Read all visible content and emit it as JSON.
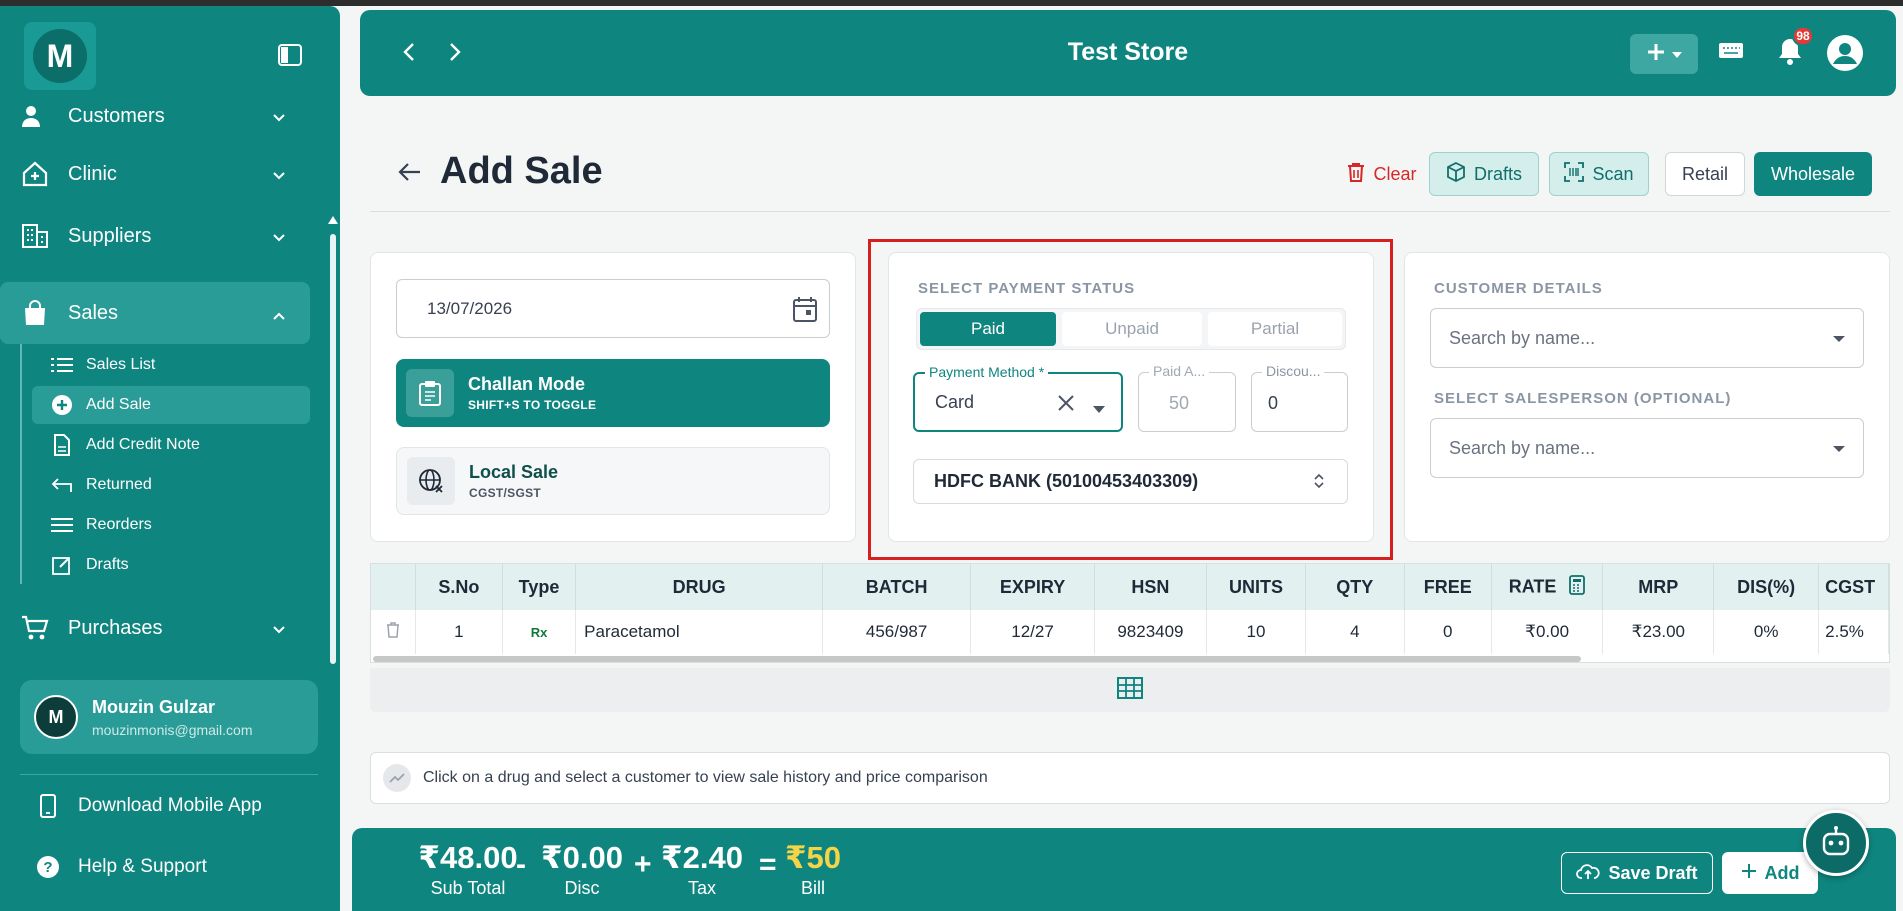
{
  "header": {
    "title": "Test Store",
    "notification_count": "98"
  },
  "sidebar": {
    "logo_letter": "M",
    "items": [
      {
        "label": "Customers",
        "icon": "users-icon"
      },
      {
        "label": "Clinic",
        "icon": "clinic-icon"
      },
      {
        "label": "Suppliers",
        "icon": "building-icon"
      },
      {
        "label": "Sales",
        "icon": "shopping-bag-icon"
      },
      {
        "label": "Purchases",
        "icon": "cart-icon"
      }
    ],
    "sales_sub": [
      {
        "label": "Sales List",
        "icon": "list-icon"
      },
      {
        "label": "Add Sale",
        "icon": "plus-circle-icon"
      },
      {
        "label": "Add Credit Note",
        "icon": "document-icon"
      },
      {
        "label": "Returned",
        "icon": "return-icon"
      },
      {
        "label": "Reorders",
        "icon": "menu-icon"
      },
      {
        "label": "Drafts",
        "icon": "edit-icon"
      }
    ],
    "user": {
      "initial": "M",
      "name": "Mouzin Gulzar",
      "email": "mouzinmonis@gmail.com"
    },
    "download_app": "Download Mobile App",
    "help": "Help & Support"
  },
  "page": {
    "title": "Add Sale",
    "buttons": {
      "clear": "Clear",
      "drafts": "Drafts",
      "scan": "Scan",
      "retail": "Retail",
      "wholesale": "Wholesale"
    }
  },
  "left_panel": {
    "date": "13/07/2026",
    "challan": {
      "title": "Challan Mode",
      "sub": "SHIFT+S TO TOGGLE"
    },
    "local": {
      "title": "Local Sale",
      "sub": "CGST/SGST"
    }
  },
  "payment": {
    "section_label": "SELECT PAYMENT STATUS",
    "statuses": [
      "Paid",
      "Unpaid",
      "Partial"
    ],
    "selected_status": "Paid",
    "method_label": "Payment Method *",
    "method_value": "Card",
    "paid_label": "Paid A...",
    "paid_value": "50",
    "discount_label": "Discou...",
    "discount_value": "0",
    "bank": "HDFC BANK (50100453403309)"
  },
  "customer": {
    "section_label": "CUSTOMER DETAILS",
    "search_placeholder": "Search by name...",
    "salesperson_label": "SELECT SALESPERSON (OPTIONAL)",
    "salesperson_placeholder": "Search by name..."
  },
  "table": {
    "columns": [
      "",
      "S.No",
      "Type",
      "DRUG",
      "BATCH",
      "EXPIRY",
      "HSN",
      "UNITS",
      "QTY",
      "FREE",
      "RATE",
      "MRP",
      "DIS(%)",
      "CGST"
    ],
    "rows": [
      [
        "",
        "1",
        "Rx",
        "Paracetamol",
        "456/987",
        "12/27",
        "9823409",
        "10",
        "4",
        "0",
        "₹0.00",
        "₹23.00",
        "0%",
        "2.5%"
      ]
    ]
  },
  "hint": "Click on a drug and select a customer to view sale history and price comparison",
  "totals": {
    "subtotal": "₹48.00",
    "subtotal_label": "Sub Total",
    "disc": "₹0.00",
    "disc_label": "Disc",
    "tax": "₹2.40",
    "tax_label": "Tax",
    "bill": "₹50",
    "bill_label": "Bill",
    "op_minus": "-",
    "op_plus": "+",
    "op_eq": "="
  },
  "bottom_buttons": {
    "save_draft": "Save Draft",
    "add": "Add"
  },
  "colors": {
    "primary": "#0f8580",
    "accent_bill": "#f5d547",
    "danger": "#d62828"
  }
}
